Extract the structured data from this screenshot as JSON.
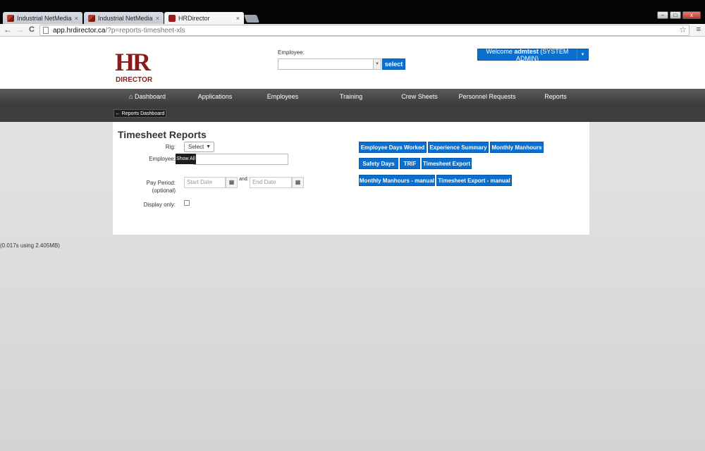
{
  "browser": {
    "tabs": [
      {
        "title": "Industrial NetMedia",
        "active": false,
        "close": "×"
      },
      {
        "title": "Industrial NetMedia",
        "active": false,
        "close": "×"
      },
      {
        "title": "HRDirector",
        "active": true,
        "close": "×"
      }
    ],
    "url_host": "app.hrdirector.ca",
    "url_path": "/?p=reports-timesheet-xls",
    "back": "←",
    "forward": "→",
    "reload": "C",
    "star": "☆",
    "menu": "≡",
    "window_buttons": {
      "minimize": "–",
      "maximize": "□",
      "close": "x"
    }
  },
  "header": {
    "logo_hr": "HR",
    "logo_director": "DIRECTOR",
    "employee_label": "Employee:",
    "employee_value": "",
    "select_button": "select",
    "welcome_prefix": "Welcome ",
    "welcome_user": "admtest",
    "welcome_suffix": " (SYSTEM ADMIN)",
    "welcome_caret": "▾"
  },
  "nav": {
    "items": [
      "Dashboard",
      "Applications",
      "Employees",
      "Training",
      "Crew Sheets",
      "Personnel Requests",
      "Reports"
    ],
    "home_icon": "⌂"
  },
  "subnav": {
    "dashboard_button": "Reports Dashboard",
    "arrow": "←"
  },
  "form": {
    "title": "Timesheet Reports",
    "rig_label": "Rig:",
    "rig_value": "Select",
    "rig_caret": "▼",
    "employee_label": "Employee:",
    "show_all": "Show All",
    "pay_period_label": "Pay Period:",
    "pay_period_optional": "(optional)",
    "start_placeholder": "Start Date",
    "and_label": "and:",
    "end_placeholder": "End Date",
    "display_only_label": "Display only:",
    "calendar_icon": "▦"
  },
  "report_buttons": [
    "Employee Days Worked",
    "Experience Summary",
    "Monthly Manhours",
    "Safety Days",
    "TRIF",
    "Timesheet Export",
    "Monthly Manhours - manual",
    "Timesheet Export - manual"
  ],
  "footer": {
    "stats": "(0.017s using 2.405MB)"
  },
  "colors": {
    "brand_red": "#8b1a1a",
    "button_blue": "#0a6fcf",
    "nav_dark": "#3e3e3e"
  }
}
